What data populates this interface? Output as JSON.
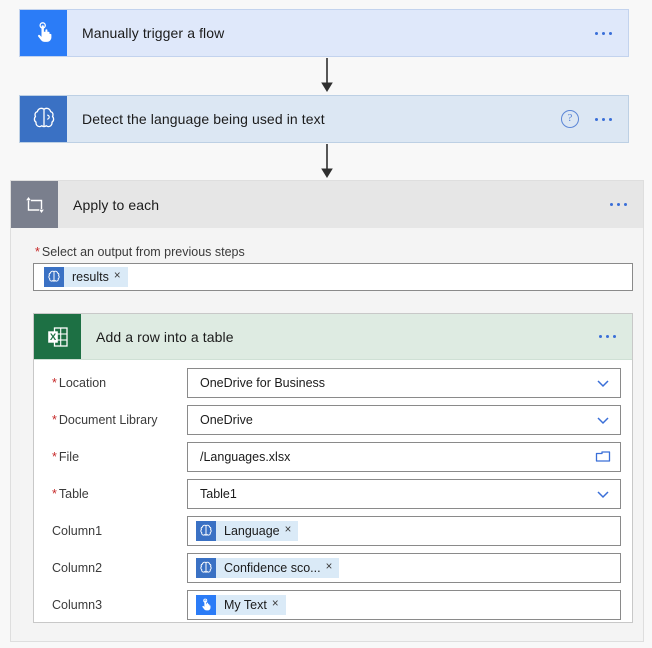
{
  "flow": {
    "trigger": {
      "title": "Manually trigger a flow",
      "icon": "hand-tap-icon",
      "icon_color": "#2b7cf7",
      "body_color": "#dfe8fa",
      "menu": "..."
    },
    "detect": {
      "title": "Detect the language being used in text",
      "icon": "brain-icon",
      "icon_color": "#3a71c4",
      "body_color": "#dce7f3",
      "help": "?",
      "menu": "..."
    },
    "apply_to_each": {
      "title": "Apply to each",
      "icon": "loop-icon",
      "icon_color": "#7a7f8d",
      "header_color": "#e6e6e6",
      "menu": "...",
      "select_output": {
        "label": "Select an output from previous steps",
        "required": true,
        "token": {
          "label": "results",
          "icon": "brain-icon",
          "close": "×"
        }
      },
      "action": {
        "title": "Add a row into a table",
        "icon": "excel-icon",
        "icon_color": "#1d7044",
        "header_color": "#deebe2",
        "menu": "...",
        "fields": [
          {
            "label": "Location",
            "required": true,
            "type": "dropdown",
            "value": "OneDrive for Business",
            "trailing_icon": "chevron-down-icon"
          },
          {
            "label": "Document Library",
            "required": true,
            "type": "dropdown",
            "value": "OneDrive",
            "trailing_icon": "chevron-down-icon"
          },
          {
            "label": "File",
            "required": true,
            "type": "filepicker",
            "value": "/Languages.xlsx",
            "trailing_icon": "folder-icon"
          },
          {
            "label": "Table",
            "required": true,
            "type": "dropdown",
            "value": "Table1",
            "trailing_icon": "chevron-down-icon"
          },
          {
            "label": "Column1",
            "required": false,
            "type": "token",
            "token": {
              "label": "Language",
              "icon": "brain-icon",
              "close": "×"
            }
          },
          {
            "label": "Column2",
            "required": false,
            "type": "token",
            "token": {
              "label": "Confidence sco...",
              "icon": "brain-icon",
              "close": "×"
            }
          },
          {
            "label": "Column3",
            "required": false,
            "type": "token",
            "token": {
              "label": "My Text",
              "icon": "hand-tap-icon",
              "close": "×"
            }
          }
        ]
      }
    }
  }
}
